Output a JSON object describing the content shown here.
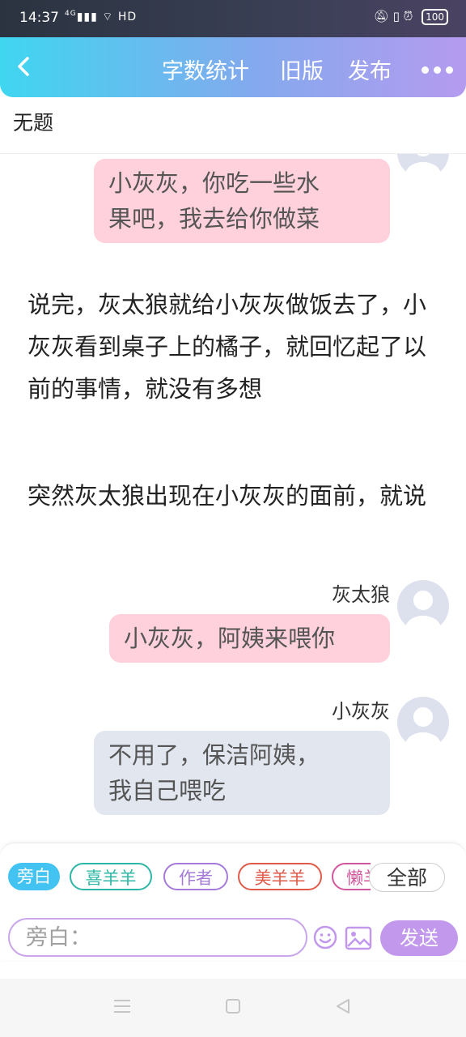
{
  "status_bar": {
    "time": "14:37",
    "network": "4G",
    "hd": "HD",
    "battery": "100"
  },
  "header": {
    "back_icon": "chevron-left-icon",
    "word_count": "字数统计",
    "old_version": "旧版",
    "publish": "发布",
    "more_icon": "more-dots-icon"
  },
  "title": "无题",
  "messages": [
    {
      "type": "dialog",
      "speaker": "",
      "text_lines": [
        "小灰灰，你吃一些水",
        "果吧，我去给你做菜"
      ],
      "color": "#ffd1dc"
    },
    {
      "type": "narration",
      "text": "说完，灰太狼就给小灰灰做饭去了，小灰灰看到桌子上的橘子，就回忆起了以前的事情，就没有多想"
    },
    {
      "type": "narration",
      "text": "突然灰太狼出现在小灰灰的面前，就说"
    },
    {
      "type": "dialog",
      "speaker": "灰太狼",
      "text_lines": [
        "小灰灰，阿姨来喂你"
      ],
      "color": "#ffd1dc"
    },
    {
      "type": "dialog",
      "speaker": "小灰灰",
      "text_lines": [
        "不用了，保洁阿姨，",
        "我自己喂吃"
      ],
      "color": "#e1e6ef"
    }
  ],
  "roles": [
    {
      "label": "旁白",
      "color": "#42c3f1",
      "active": true
    },
    {
      "label": "喜羊羊",
      "color": "#2cb7a6",
      "active": false
    },
    {
      "label": "作者",
      "color": "#a57ad8",
      "active": false
    },
    {
      "label": "美羊羊",
      "color": "#e05a4a",
      "active": false
    },
    {
      "label": "懒羊羊",
      "color": "#d3569c",
      "active": false
    }
  ],
  "all_button": "全部",
  "input": {
    "placeholder": "旁白：",
    "value": ""
  },
  "send_button": "发送",
  "icons": {
    "emoji": "smiley-icon",
    "image": "image-icon",
    "nav_menu": "menu-icon",
    "nav_home": "square-home-icon",
    "nav_back": "triangle-back-icon"
  }
}
